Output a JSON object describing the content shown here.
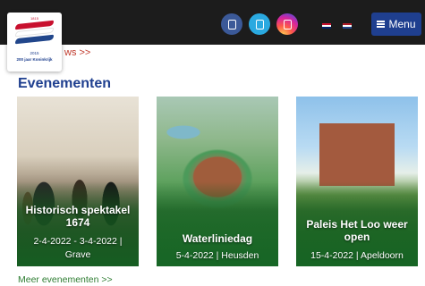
{
  "header": {
    "logo": {
      "top_text": "1815",
      "line1": "2015",
      "line2": "200 jaar Koninkrijk"
    },
    "social": [
      {
        "icon": "facebook-icon",
        "color": "#3b5998"
      },
      {
        "icon": "twitter-icon",
        "color": "#2aa9e0"
      },
      {
        "icon": "instagram-icon",
        "color": "#d6249f"
      }
    ],
    "languages": [
      {
        "icon": "flag-en-icon"
      },
      {
        "icon": "flag-nl-icon"
      }
    ],
    "menu_label": "Menu"
  },
  "news_link": "ws >>",
  "section_title": "Evenementen",
  "events": [
    {
      "title": "Historisch spektakel 1674",
      "meta": "2-4-2022 - 3-4-2022 | Grave"
    },
    {
      "title": "Waterliniedag",
      "meta": "5-4-2022 | Heusden"
    },
    {
      "title": "Paleis Het Loo weer open",
      "meta": "15-4-2022 | Apeldoorn"
    }
  ],
  "more_events": "Meer evenementen >>",
  "colors": {
    "topbar": "#1c1c1c",
    "accent_blue": "#1f3f8f",
    "green": "#2e7d32",
    "red": "#c0392b"
  }
}
